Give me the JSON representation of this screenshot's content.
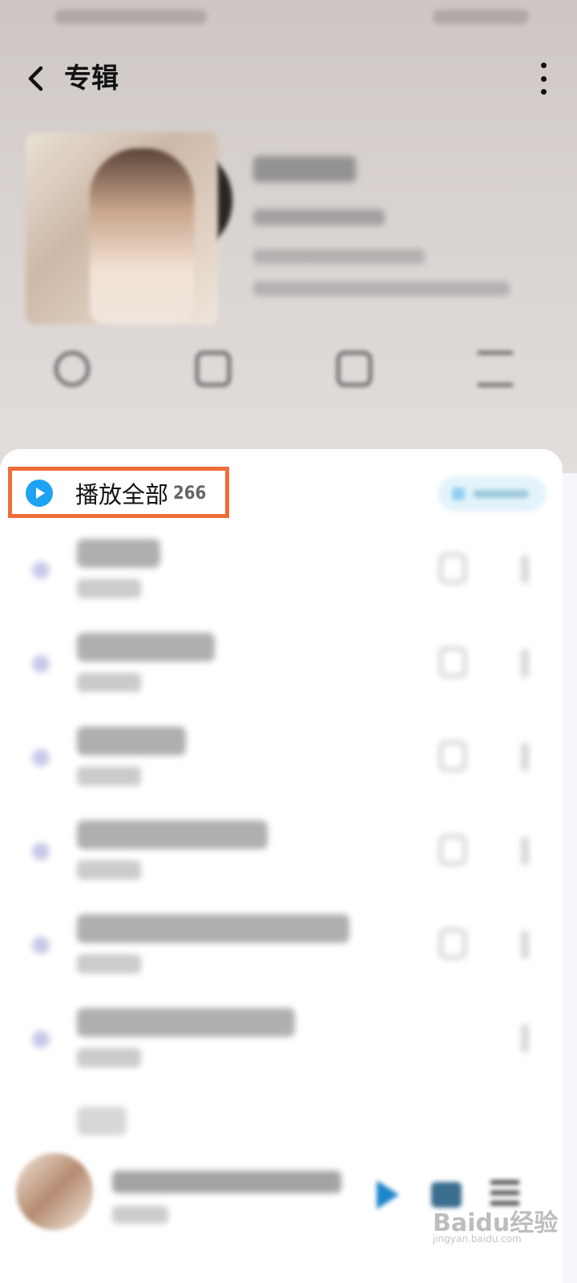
{
  "header": {
    "title": "专辑"
  },
  "play_all": {
    "label": "播放全部",
    "count": "266"
  },
  "actions": [
    {
      "icon": "share-icon"
    },
    {
      "icon": "download-icon"
    },
    {
      "icon": "comment-icon"
    },
    {
      "icon": "select-list-icon"
    }
  ],
  "songs_count_visible": 6,
  "watermark": {
    "text": "Baidu经验",
    "sub": "jingyan.baidu.com"
  },
  "colors": {
    "accent": "#1ea3f2",
    "highlight_box": "#ee6d3a",
    "text": "#111111"
  }
}
